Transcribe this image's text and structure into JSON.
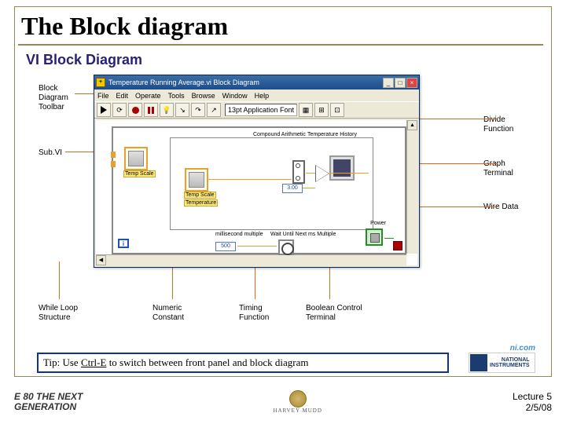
{
  "slide": {
    "title": "The Block diagram",
    "subtitle": "VI Block Diagram",
    "tip": "Tip: Use Ctrl-E to switch between front panel and block diagram",
    "tip_underline": "Ctrl-E"
  },
  "labels": {
    "toolbar": "Block Diagram Toolbar",
    "subvi": "Sub.VI",
    "divide": "Divide Function",
    "graph": "Graph Terminal",
    "wire": "Wire Data",
    "while": "While Loop Structure",
    "numeric": "Numeric Constant",
    "timing": "Timing Function",
    "boolean": "Boolean Control Terminal"
  },
  "window": {
    "title": "Temperature Running Average.vi Block Diagram",
    "menu": [
      "File",
      "Edit",
      "Operate",
      "Tools",
      "Browse",
      "Window",
      "Help"
    ],
    "font_selector": "13pt Application Font"
  },
  "diagram": {
    "compound_arith": "Compound Arithmetic",
    "temp_history": "Temperature History",
    "ms_multiple": "millisecond multiple",
    "wait_until": "Wait Until Next ms Multiple",
    "power": "Power",
    "subvi_caption1": "Temp Scale",
    "subvi_caption2": "Temp Scale",
    "subvi_caption2b": "Temperature",
    "num_const1": "3.00",
    "num_const2": "500",
    "loop_i": "i"
  },
  "logos": {
    "ni_com": "ni.com",
    "ni_text1": "NATIONAL",
    "ni_text2": "INSTRUMENTS",
    "hm": "HARVEY MUDD"
  },
  "footer": {
    "left1": "E 80 THE NEXT",
    "left2": "GENERATION",
    "right1": "Lecture 5",
    "right2": "2/5/08"
  }
}
